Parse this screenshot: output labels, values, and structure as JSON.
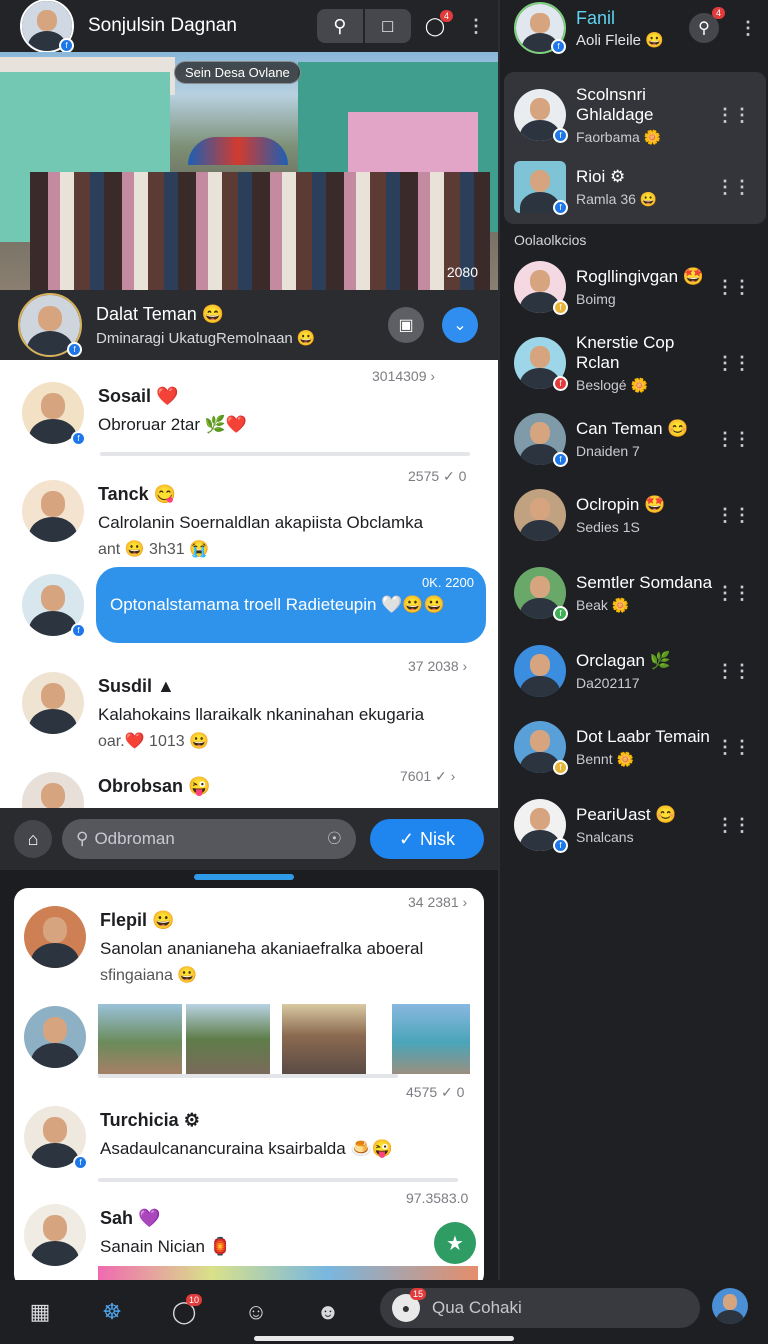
{
  "header": {
    "title": "Sonjulsin Dagnan",
    "badge": "4"
  },
  "hero": {
    "tag": "Sein Desa Ovlane",
    "count": "2080"
  },
  "profile": {
    "name": "Dalat Teman 😄",
    "subtitle": "Dminaragi UkatugRemolnaan 😀"
  },
  "feed": [
    {
      "name": "Sosail ❤️",
      "text": "Obroruar 2tar 🌿❤️",
      "sub": "",
      "meta": "3014309 ›"
    },
    {
      "name": "Tanck 😋",
      "text": "Calrolanin Soernaldlan akapiista Obclamka",
      "sub": "ant 😀 3h31 😭",
      "meta": "2575 ✓ 0"
    },
    {
      "bubble": "Optonalstamama troell Radieteupin 🤍😀😀",
      "meta": "0K. 2200"
    },
    {
      "name": "Susdil ▲",
      "text": "Kalahokains llaraikalk nkaninahan ekugaria",
      "sub": "oar.❤️ 1013 😀",
      "meta": "37 2038 ›"
    },
    {
      "name": "Obrobsan 😜",
      "text": "",
      "sub": "",
      "meta": "7601 ✓ ›"
    }
  ],
  "searchbar": {
    "placeholder": "Odbroman",
    "button": "Nisk"
  },
  "card": [
    {
      "name": "Flepil 😀",
      "text": "Sanolan ananianeha akaniaefralka aboeral",
      "sub": "sfingaiana 😀",
      "meta": "34 2381 ›"
    },
    {
      "meta": "4575 ✓ 0"
    },
    {
      "name": "Turchicia ⚙",
      "text": "Asadaulcanancuraina ksairbalda 🍮😜",
      "sub": "",
      "meta": ""
    },
    {
      "name": "Sah 💜",
      "text": "Sanain Nician 🏮",
      "sub": "",
      "meta": "97.3583.0"
    }
  ],
  "bottomnav": {
    "search": "Qua Cohaki",
    "badge1": "10",
    "badge2": "15"
  },
  "rightpanel": {
    "title": "Fanil",
    "subtitle": "Aoli Fleile 😀",
    "badge": "4",
    "selected": [
      {
        "name": "Scolnsnri Ghlaldage",
        "sub": "Faorbama 🌼"
      },
      {
        "name": "Rioi ⚙",
        "sub": "Ramla 36 😀"
      }
    ],
    "section": "Oolaolkcios",
    "contacts": [
      {
        "name": "Rogllingivgan 🤩",
        "sub": "Boimg"
      },
      {
        "name": "Knerstie Cop Rclan",
        "sub": "Beslogé 🌼"
      },
      {
        "name": "Can Teman 😊",
        "sub": "Dnaiden 7"
      },
      {
        "name": "Oclropin 🤩",
        "sub": "Sedies 1S"
      },
      {
        "name": "Semtler Somdana",
        "sub": "Beak 🌼"
      },
      {
        "name": "Orclagan 🌿",
        "sub": "Da202117"
      },
      {
        "name": "Dot Laabr Temain",
        "sub": "Bennt 🌼"
      },
      {
        "name": "PeariUast 😊",
        "sub": "Snalcans"
      }
    ]
  },
  "colors": {
    "accent": "#1f86ef",
    "panel": "#1f2024",
    "feedbg": "#ffffff"
  }
}
